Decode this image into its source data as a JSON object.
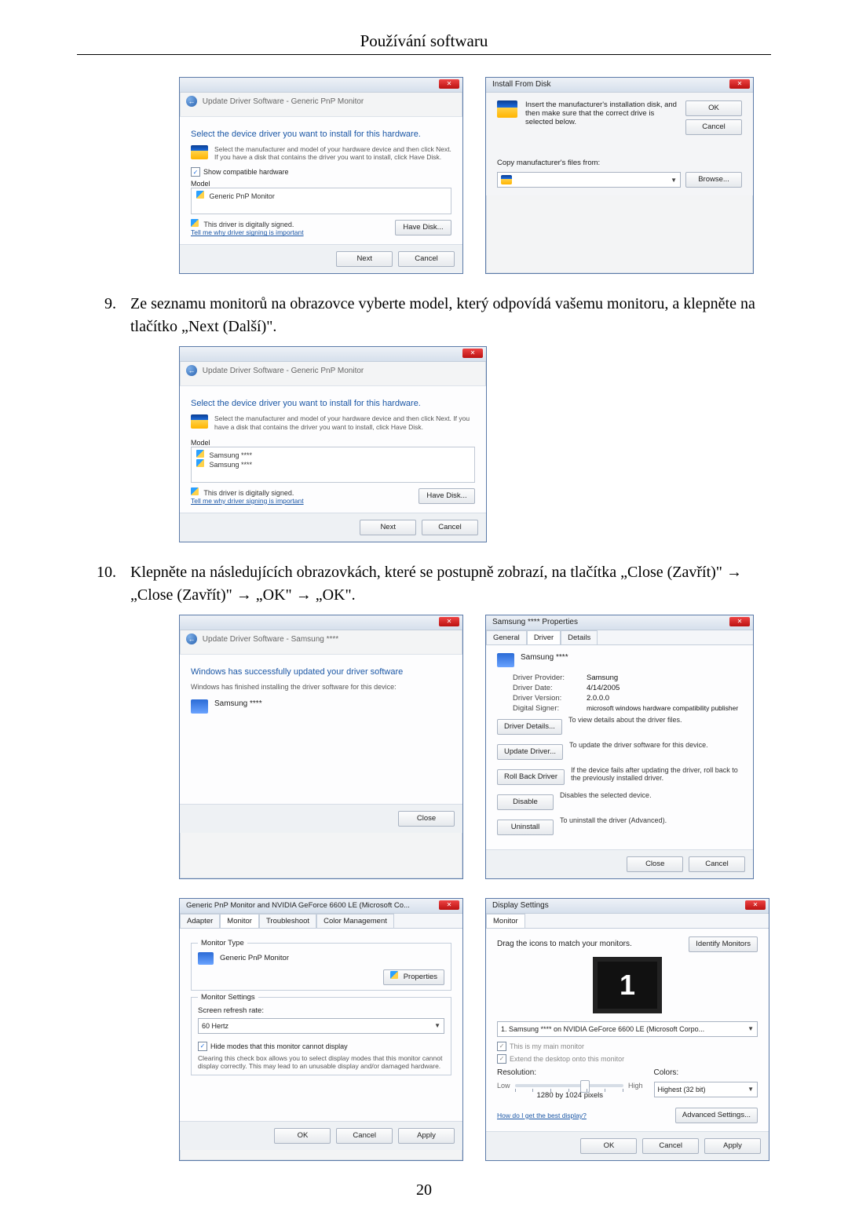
{
  "page": {
    "section_title": "Používání softwaru",
    "page_number": "20"
  },
  "steps": {
    "s9_num": "9.",
    "s9_text": "Ze seznamu monitorů na obrazovce vyberte model, který odpovídá vašemu monitoru, a klepněte na tlačítko „Next (Další)\".",
    "s10_num": "10.",
    "s10_text": "Klepněte na následujících obrazovkách, které se postupně zobrazí, na tlačítka „Close (Zavřít)\" → „Close (Zavřít)\" → „OK\" → „OK\"."
  },
  "dlg_select1": {
    "breadcrumb": "Update Driver Software - Generic PnP Monitor",
    "heading": "Select the device driver you want to install for this hardware.",
    "hint": "Select the manufacturer and model of your hardware device and then click Next. If you have a disk that contains the driver you want to install, click Have Disk.",
    "show_compat": "Show compatible hardware",
    "model_label": "Model",
    "model_item": "Generic PnP Monitor",
    "signed": "This driver is digitally signed.",
    "why_link": "Tell me why driver signing is important",
    "have_disk": "Have Disk...",
    "next": "Next",
    "cancel": "Cancel"
  },
  "dlg_install": {
    "title": "Install From Disk",
    "msg": "Insert the manufacturer's installation disk, and then make sure that the correct drive is selected below.",
    "ok": "OK",
    "cancel": "Cancel",
    "copy_label": "Copy manufacturer's files from:",
    "browse": "Browse..."
  },
  "dlg_select2": {
    "breadcrumb": "Update Driver Software - Generic PnP Monitor",
    "heading": "Select the device driver you want to install for this hardware.",
    "hint": "Select the manufacturer and model of your hardware device and then click Next. If you have a disk that contains the driver you want to install, click Have Disk.",
    "model_label": "Model",
    "model_item1": "Samsung ****",
    "model_item2": "Samsung ****",
    "signed": "This driver is digitally signed.",
    "why_link": "Tell me why driver signing is important",
    "have_disk": "Have Disk...",
    "next": "Next",
    "cancel": "Cancel"
  },
  "dlg_done": {
    "breadcrumb": "Update Driver Software - Samsung ****",
    "heading": "Windows has successfully updated your driver software",
    "sub": "Windows has finished installing the driver software for this device:",
    "device": "Samsung ****",
    "close": "Close"
  },
  "dlg_props": {
    "title": "Samsung **** Properties",
    "tab_general": "General",
    "tab_driver": "Driver",
    "tab_details": "Details",
    "device": "Samsung ****",
    "provider_k": "Driver Provider:",
    "provider_v": "Samsung",
    "date_k": "Driver Date:",
    "date_v": "4/14/2005",
    "ver_k": "Driver Version:",
    "ver_v": "2.0.0.0",
    "signer_k": "Digital Signer:",
    "signer_v": "microsoft windows hardware compatibility publisher",
    "details_btn": "Driver Details...",
    "details_desc": "To view details about the driver files.",
    "update_btn": "Update Driver...",
    "update_desc": "To update the driver software for this device.",
    "rollback_btn": "Roll Back Driver",
    "rollback_desc": "If the device fails after updating the driver, roll back to the previously installed driver.",
    "disable_btn": "Disable",
    "disable_desc": "Disables the selected device.",
    "uninstall_btn": "Uninstall",
    "uninstall_desc": "To uninstall the driver (Advanced).",
    "close": "Close",
    "cancel": "Cancel"
  },
  "dlg_monitor": {
    "title": "Generic PnP Monitor and NVIDIA GeForce 6600 LE (Microsoft Co...",
    "tab_adapter": "Adapter",
    "tab_monitor": "Monitor",
    "tab_troubleshoot": "Troubleshoot",
    "tab_color": "Color Management",
    "type_legend": "Monitor Type",
    "type_value": "Generic PnP Monitor",
    "properties_btn": "Properties",
    "settings_legend": "Monitor Settings",
    "refresh_label": "Screen refresh rate:",
    "refresh_value": "60 Hertz",
    "hide_chk": "Hide modes that this monitor cannot display",
    "hide_note": "Clearing this check box allows you to select display modes that this monitor cannot display correctly. This may lead to an unusable display and/or damaged hardware.",
    "ok": "OK",
    "cancel": "Cancel",
    "apply": "Apply"
  },
  "dlg_display": {
    "title": "Display Settings",
    "tab_monitor": "Monitor",
    "drag_hint": "Drag the icons to match your monitors.",
    "identify": "Identify Monitors",
    "monitor_num": "1",
    "selector": "1. Samsung **** on NVIDIA GeForce 6600 LE (Microsoft Corpo...",
    "main_chk": "This is my main monitor",
    "extend_chk": "Extend the desktop onto this monitor",
    "res_label": "Resolution:",
    "res_low": "Low",
    "res_high": "High",
    "res_value": "1280 by 1024 pixels",
    "colors_label": "Colors:",
    "colors_value": "Highest (32 bit)",
    "best_link": "How do I get the best display?",
    "advanced": "Advanced Settings...",
    "ok": "OK",
    "cancel": "Cancel",
    "apply": "Apply"
  }
}
